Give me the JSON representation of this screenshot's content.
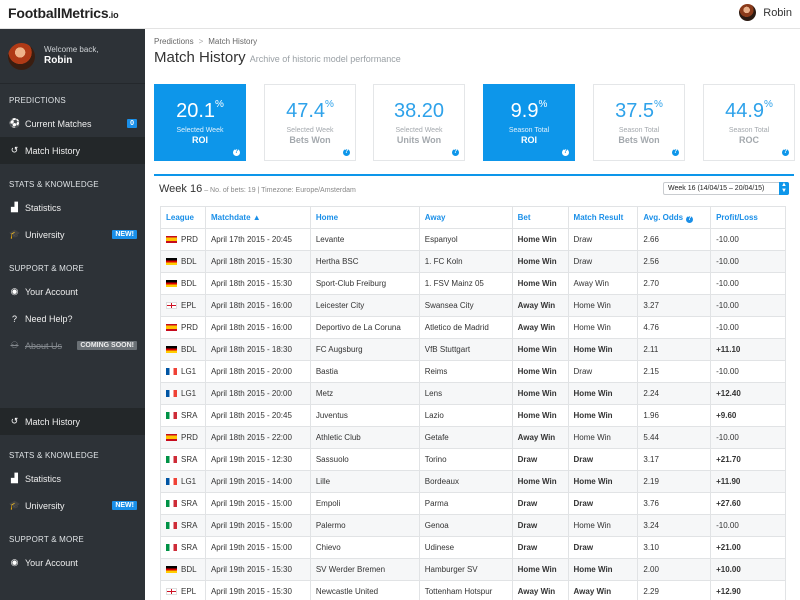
{
  "brand": {
    "name": "FootballMetrics",
    "tld": ".io"
  },
  "topbar": {
    "username": "Robin"
  },
  "sidebar": {
    "welcome": "Welcome back,",
    "name": "Robin",
    "sections": [
      {
        "title": "PREDICTIONS",
        "items": [
          {
            "label": "Current Matches",
            "icon": "soccer-ball-icon",
            "badge": "0"
          },
          {
            "label": "Match History",
            "icon": "history-icon",
            "active": true
          }
        ]
      },
      {
        "title": "STATS & KNOWLEDGE",
        "items": [
          {
            "label": "Statistics",
            "icon": "chart-icon"
          },
          {
            "label": "University",
            "icon": "graduation-cap-icon",
            "badge": "NEW!"
          }
        ]
      },
      {
        "title": "SUPPORT & MORE",
        "items": [
          {
            "label": "Your Account",
            "icon": "user-icon"
          },
          {
            "label": "Need Help?",
            "icon": "help-icon"
          },
          {
            "label": "About Us",
            "icon": "users-icon",
            "badge": "COMING SOON!",
            "disabled": true
          }
        ]
      }
    ],
    "repeat": [
      {
        "type": "item",
        "label": "Match History",
        "icon": "history-icon",
        "active": true
      },
      {
        "type": "head",
        "title": "STATS & KNOWLEDGE"
      },
      {
        "type": "item",
        "label": "Statistics",
        "icon": "chart-icon"
      },
      {
        "type": "item",
        "label": "University",
        "icon": "graduation-cap-icon",
        "badge": "NEW!"
      },
      {
        "type": "head",
        "title": "SUPPORT & MORE"
      },
      {
        "type": "item",
        "label": "Your Account",
        "icon": "user-icon"
      }
    ]
  },
  "breadcrumb": [
    "Predictions",
    "Match History"
  ],
  "page": {
    "title": "Match History",
    "subtitle": "Archive of historic model performance"
  },
  "cards": [
    {
      "value": "20.1",
      "unit": "%",
      "label": "Selected Week",
      "sub": "ROI",
      "highlight": true
    },
    {
      "value": "47.4",
      "unit": "%",
      "label": "Selected Week",
      "sub": "Bets Won",
      "highlight": false
    },
    {
      "value": "38.20",
      "unit": "",
      "label": "Selected Week",
      "sub": "Units Won",
      "highlight": false
    },
    {
      "value": "9.9",
      "unit": "%",
      "label": "Season Total",
      "sub": "ROI",
      "highlight": true
    },
    {
      "value": "37.5",
      "unit": "%",
      "label": "Season Total",
      "sub": "Bets Won",
      "highlight": false
    },
    {
      "value": "44.9",
      "unit": "%",
      "label": "Season Total",
      "sub": "ROC",
      "highlight": false
    }
  ],
  "week": {
    "title": "Week 16",
    "meta": "– No. of bets: 19 | Timezone: Europe/Amsterdam",
    "select": "Week 16 (14/04/15 – 20/04/15)"
  },
  "table": {
    "headers": [
      "League",
      "Matchdate ▲",
      "Home",
      "Away",
      "Bet",
      "Match Result",
      "Avg. Odds",
      "Profit/Loss"
    ],
    "rows": [
      {
        "flag": "es",
        "league": "PRD",
        "date": "April 17th 2015 - 20:45",
        "home": "Levante",
        "away": "Espanyol",
        "bet": "Home Win",
        "result": "Draw",
        "odds": "2.66",
        "pl": "-10.00"
      },
      {
        "flag": "de",
        "league": "BDL",
        "date": "April 18th 2015 - 15:30",
        "home": "Hertha BSC",
        "away": "1. FC Koln",
        "bet": "Home Win",
        "result": "Draw",
        "odds": "2.56",
        "pl": "-10.00"
      },
      {
        "flag": "de",
        "league": "BDL",
        "date": "April 18th 2015 - 15:30",
        "home": "Sport-Club Freiburg",
        "away": "1. FSV Mainz 05",
        "bet": "Home Win",
        "result": "Away Win",
        "odds": "2.70",
        "pl": "-10.00"
      },
      {
        "flag": "en",
        "league": "EPL",
        "date": "April 18th 2015 - 16:00",
        "home": "Leicester City",
        "away": "Swansea City",
        "bet": "Away Win",
        "result": "Home Win",
        "odds": "3.27",
        "pl": "-10.00"
      },
      {
        "flag": "es",
        "league": "PRD",
        "date": "April 18th 2015 - 16:00",
        "home": "Deportivo de La Coruna",
        "away": "Atletico de Madrid",
        "bet": "Away Win",
        "result": "Home Win",
        "odds": "4.76",
        "pl": "-10.00"
      },
      {
        "flag": "de",
        "league": "BDL",
        "date": "April 18th 2015 - 18:30",
        "home": "FC Augsburg",
        "away": "VfB Stuttgart",
        "bet": "Home Win",
        "result": "Home Win",
        "odds": "2.11",
        "pl": "+11.10"
      },
      {
        "flag": "fr",
        "league": "LG1",
        "date": "April 18th 2015 - 20:00",
        "home": "Bastia",
        "away": "Reims",
        "bet": "Home Win",
        "result": "Draw",
        "odds": "2.15",
        "pl": "-10.00"
      },
      {
        "flag": "fr",
        "league": "LG1",
        "date": "April 18th 2015 - 20:00",
        "home": "Metz",
        "away": "Lens",
        "bet": "Home Win",
        "result": "Home Win",
        "odds": "2.24",
        "pl": "+12.40"
      },
      {
        "flag": "it",
        "league": "SRA",
        "date": "April 18th 2015 - 20:45",
        "home": "Juventus",
        "away": "Lazio",
        "bet": "Home Win",
        "result": "Home Win",
        "odds": "1.96",
        "pl": "+9.60"
      },
      {
        "flag": "es",
        "league": "PRD",
        "date": "April 18th 2015 - 22:00",
        "home": "Athletic Club",
        "away": "Getafe",
        "bet": "Away Win",
        "result": "Home Win",
        "odds": "5.44",
        "pl": "-10.00"
      },
      {
        "flag": "it",
        "league": "SRA",
        "date": "April 19th 2015 - 12:30",
        "home": "Sassuolo",
        "away": "Torino",
        "bet": "Draw",
        "result": "Draw",
        "odds": "3.17",
        "pl": "+21.70"
      },
      {
        "flag": "fr",
        "league": "LG1",
        "date": "April 19th 2015 - 14:00",
        "home": "Lille",
        "away": "Bordeaux",
        "bet": "Home Win",
        "result": "Home Win",
        "odds": "2.19",
        "pl": "+11.90"
      },
      {
        "flag": "it",
        "league": "SRA",
        "date": "April 19th 2015 - 15:00",
        "home": "Empoli",
        "away": "Parma",
        "bet": "Draw",
        "result": "Draw",
        "odds": "3.76",
        "pl": "+27.60"
      },
      {
        "flag": "it",
        "league": "SRA",
        "date": "April 19th 2015 - 15:00",
        "home": "Palermo",
        "away": "Genoa",
        "bet": "Draw",
        "result": "Home Win",
        "odds": "3.24",
        "pl": "-10.00"
      },
      {
        "flag": "it",
        "league": "SRA",
        "date": "April 19th 2015 - 15:00",
        "home": "Chievo",
        "away": "Udinese",
        "bet": "Draw",
        "result": "Draw",
        "odds": "3.10",
        "pl": "+21.00"
      },
      {
        "flag": "de",
        "league": "BDL",
        "date": "April 19th 2015 - 15:30",
        "home": "SV Werder Bremen",
        "away": "Hamburger SV",
        "bet": "Home Win",
        "result": "Home Win",
        "odds": "2.00",
        "pl": "+10.00"
      },
      {
        "flag": "en",
        "league": "EPL",
        "date": "April 19th 2015 - 15:30",
        "home": "Newcastle United",
        "away": "Tottenham Hotspur",
        "bet": "Away Win",
        "result": "Away Win",
        "odds": "2.29",
        "pl": "+12.90"
      }
    ]
  },
  "colors": {
    "accent": "#0d96ea",
    "sidebar": "#2d3237",
    "link": "#1a8fe8"
  }
}
